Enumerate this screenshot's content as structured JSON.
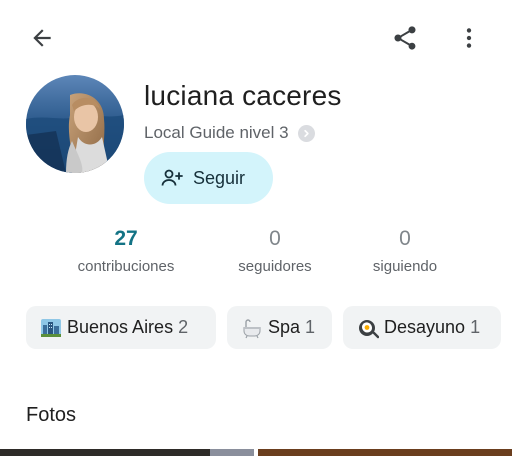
{
  "profile": {
    "name": "luciana caceres",
    "level": "Local Guide nivel 3",
    "follow_label": "Seguir"
  },
  "stats": [
    {
      "value": "27",
      "label": "contribuciones"
    },
    {
      "value": "0",
      "label": "seguidores"
    },
    {
      "value": "0",
      "label": "siguiendo"
    }
  ],
  "chips": [
    {
      "icon": "city-icon",
      "label": "Buenos Aires",
      "count": "2"
    },
    {
      "icon": "bathtub-icon",
      "label": "Spa",
      "count": "1"
    },
    {
      "icon": "fried-egg-icon",
      "label": "Desayuno",
      "count": "1"
    }
  ],
  "photos": {
    "title": "Fotos"
  },
  "colors": {
    "accent": "#137385",
    "follow_bg": "#d3f4fb",
    "chip_bg": "#f1f3f4"
  }
}
